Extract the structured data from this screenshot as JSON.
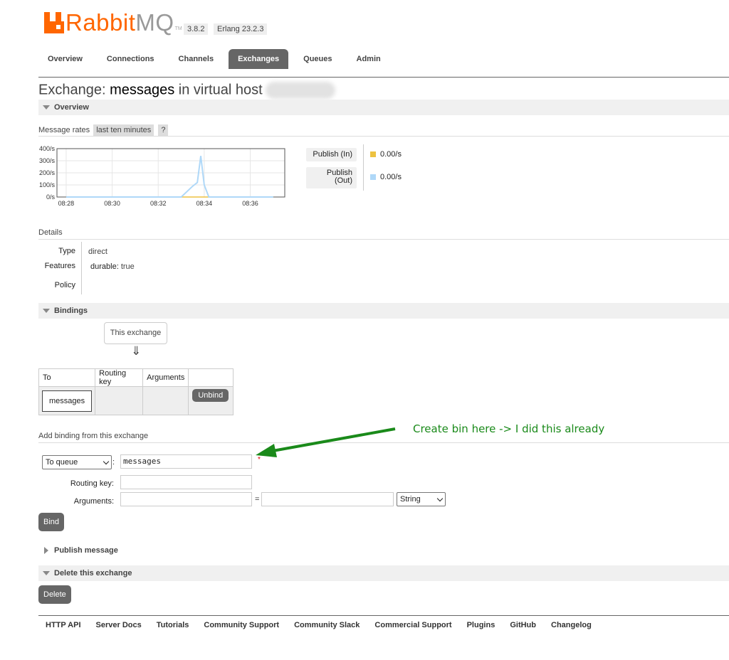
{
  "header": {
    "logo_text_1": "Rabbit",
    "logo_text_2": "MQ",
    "logo_tm": "TM",
    "version": "3.8.2",
    "erlang": "Erlang 23.2.3"
  },
  "nav": {
    "tabs": [
      {
        "label": "Overview"
      },
      {
        "label": "Connections"
      },
      {
        "label": "Channels"
      },
      {
        "label": "Exchanges",
        "active": true
      },
      {
        "label": "Queues"
      },
      {
        "label": "Admin"
      }
    ]
  },
  "title": {
    "prefix": "Exchange: ",
    "name": "messages",
    "middle": " in virtual host"
  },
  "overview": {
    "section": "Overview",
    "rates_label": "Message rates",
    "range": "last ten minutes",
    "help": "?",
    "legend": [
      {
        "label": "Publish (In)",
        "value": "0.00/s",
        "color": "#edc240"
      },
      {
        "label_1": "Publish",
        "label_2": "(Out)",
        "value": "0.00/s",
        "color": "#afd8f8"
      }
    ]
  },
  "chart_data": {
    "type": "line",
    "x": [
      "08:28",
      "08:29",
      "08:30",
      "08:31",
      "08:32",
      "08:33",
      "08:33.5",
      "08:33.7",
      "08:33.85",
      "08:34",
      "08:34.2",
      "08:35",
      "08:36",
      "08:37"
    ],
    "x_ticks": [
      "08:28",
      "08:30",
      "08:32",
      "08:34",
      "08:36"
    ],
    "y_ticks": [
      "400/s",
      "300/s",
      "200/s",
      "100/s",
      "0/s"
    ],
    "ylim": [
      0,
      400
    ],
    "series": [
      {
        "name": "Publish (In)",
        "color": "#edc240",
        "values": [
          0,
          0,
          0,
          0,
          0,
          0,
          0,
          0,
          0,
          0,
          0,
          0,
          0,
          0
        ]
      },
      {
        "name": "Publish (Out)",
        "color": "#afd8f8",
        "values": [
          0,
          0,
          0,
          0,
          0,
          0,
          90,
          120,
          340,
          100,
          0,
          0,
          0,
          0
        ]
      }
    ],
    "grid": true
  },
  "details": {
    "label": "Details",
    "type_label": "Type",
    "type_value": "direct",
    "features_label": "Features",
    "features_key": "durable:",
    "features_value": "true",
    "policy_label": "Policy"
  },
  "bindings": {
    "section": "Bindings",
    "this_exchange": "This exchange",
    "arrow": "⇓",
    "headers": [
      "To",
      "Routing key",
      "Arguments",
      ""
    ],
    "rows": [
      {
        "to": "messages",
        "routing_key": "",
        "arguments": "",
        "action": "Unbind"
      }
    ]
  },
  "add_binding": {
    "label": "Add binding from this exchange",
    "destination_type": "To queue",
    "destination_value": "messages",
    "required": "*",
    "routing_key_label": "Routing key:",
    "routing_key_value": "",
    "arguments_label": "Arguments:",
    "equals": "=",
    "arg_type": "String",
    "bind_button": "Bind",
    "colon": ":"
  },
  "annotation": {
    "text": "Create bin here -> I did this already",
    "color": "#1a8a1a"
  },
  "publish": {
    "section": "Publish message"
  },
  "delete": {
    "section": "Delete this exchange",
    "button": "Delete"
  },
  "footer": {
    "links": [
      "HTTP API",
      "Server Docs",
      "Tutorials",
      "Community Support",
      "Community Slack",
      "Commercial Support",
      "Plugins",
      "GitHub",
      "Changelog"
    ]
  }
}
